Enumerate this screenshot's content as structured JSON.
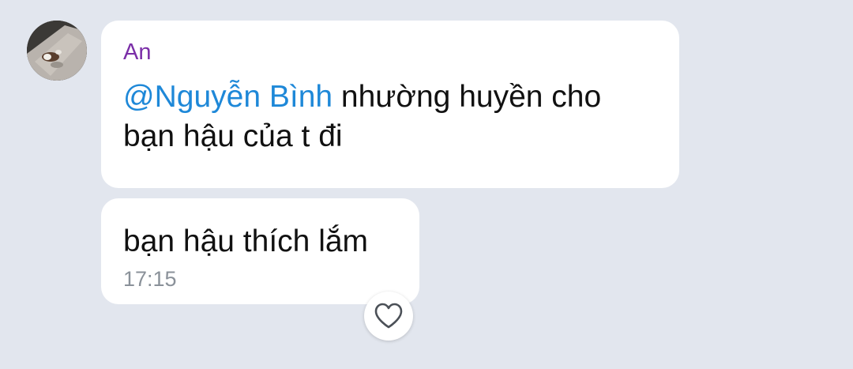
{
  "messages": [
    {
      "sender": "An",
      "mention": "@Nguyễn Bình",
      "text": " nhường huyền cho bạn hậu của t đi"
    },
    {
      "text": "bạn hậu thích lắm",
      "time": "17:15"
    }
  ],
  "reaction": {
    "icon": "heart-outline-icon"
  },
  "colors": {
    "background": "#e2e6ee",
    "bubble": "#ffffff",
    "sender_name": "#7b2fa8",
    "mention": "#1e88d8",
    "timestamp": "#8a9199"
  }
}
